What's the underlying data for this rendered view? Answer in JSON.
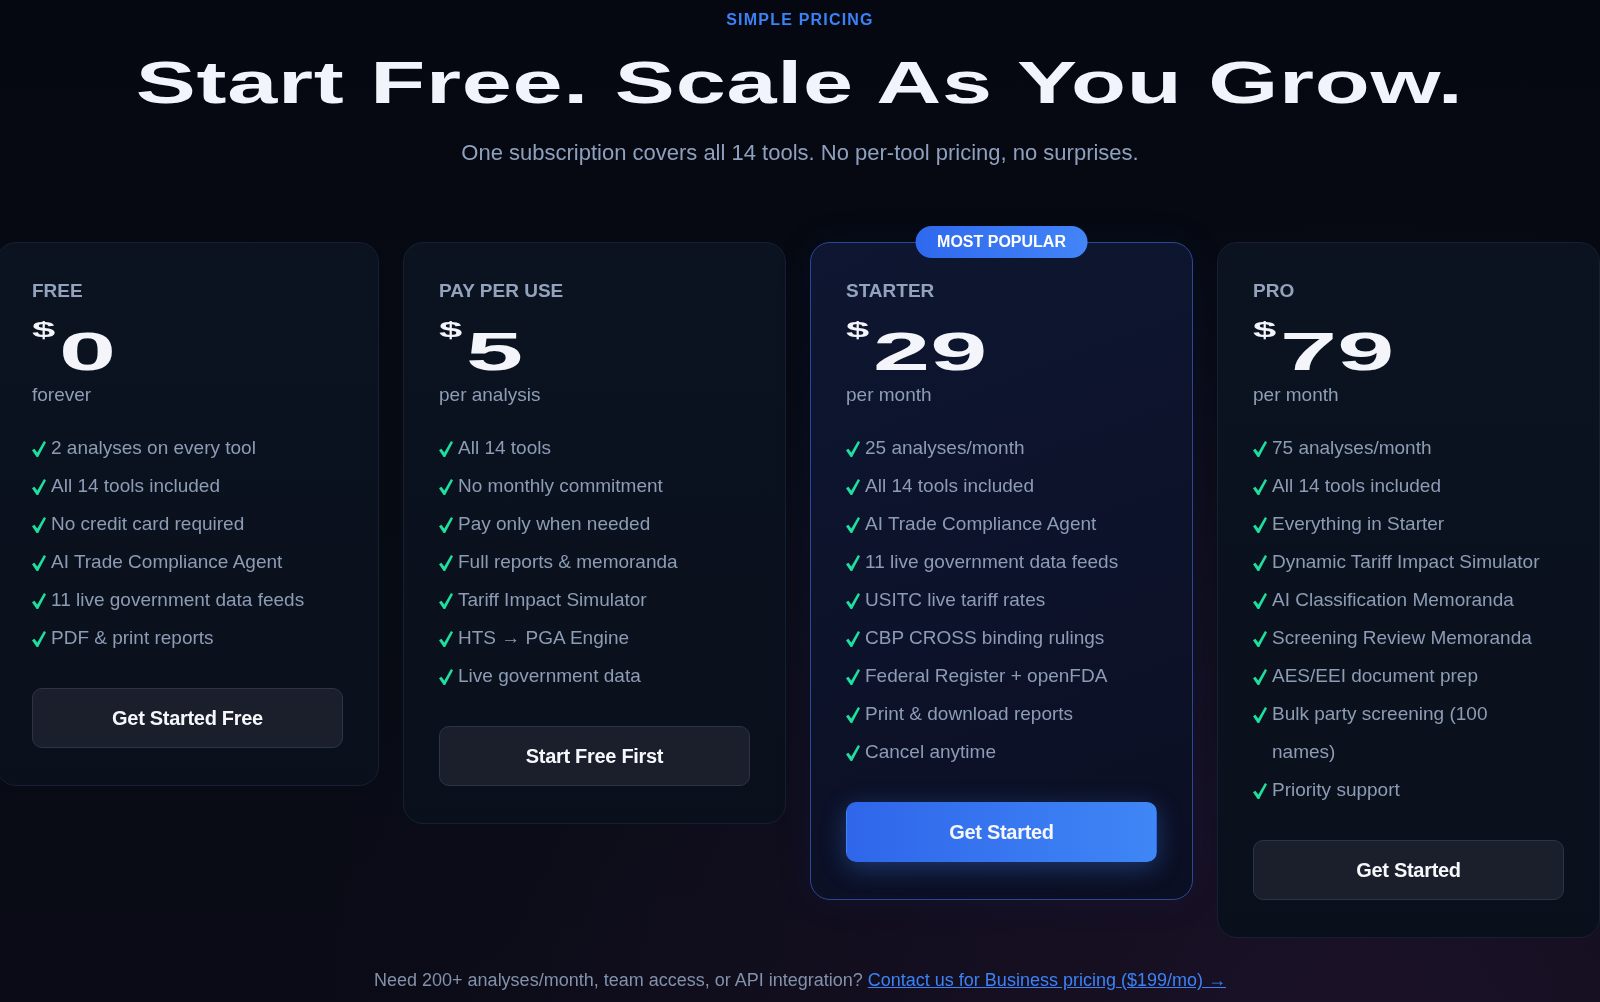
{
  "header": {
    "eyebrow": "SIMPLE PRICING",
    "title": "Start Free. Scale As You Grow.",
    "subtitle": "One subscription covers all 14 tools. No per-tool pricing, no surprises."
  },
  "plans": [
    {
      "name": "FREE",
      "currency": "$",
      "amount": "0",
      "period": "forever",
      "featured": false,
      "features": [
        "2 analyses on every tool",
        "All 14 tools included",
        "No credit card required",
        "AI Trade Compliance Agent",
        "11 live government data feeds",
        "PDF & print reports"
      ],
      "button": "Get Started Free"
    },
    {
      "name": "PAY PER USE",
      "currency": "$",
      "amount": "5",
      "period": "per analysis",
      "featured": false,
      "features": [
        "All 14 tools",
        "No monthly commitment",
        "Pay only when needed",
        "Full reports & memoranda",
        "Tariff Impact Simulator",
        "HTS → PGA Engine",
        "Live government data"
      ],
      "button": "Start Free First"
    },
    {
      "name": "STARTER",
      "currency": "$",
      "amount": "29",
      "period": "per month",
      "featured": true,
      "badge": "MOST POPULAR",
      "features": [
        "25 analyses/month",
        "All 14 tools included",
        "AI Trade Compliance Agent",
        "11 live government data feeds",
        "USITC live tariff rates",
        "CBP CROSS binding rulings",
        "Federal Register + openFDA",
        "Print & download reports",
        "Cancel anytime"
      ],
      "button": "Get Started"
    },
    {
      "name": "PRO",
      "currency": "$",
      "amount": "79",
      "period": "per month",
      "featured": false,
      "features": [
        "75 analyses/month",
        "All 14 tools included",
        "Everything in Starter",
        "Dynamic Tariff Impact Simulator",
        "AI Classification Memoranda",
        "Screening Review Memoranda",
        "AES/EEI document prep",
        "Bulk party screening (100 names)",
        "Priority support"
      ],
      "button": "Get Started"
    }
  ],
  "footer": {
    "text": "Need 200+ analyses/month, team access, or API integration?",
    "link": "Contact us for Business pricing ($199/mo) →"
  }
}
